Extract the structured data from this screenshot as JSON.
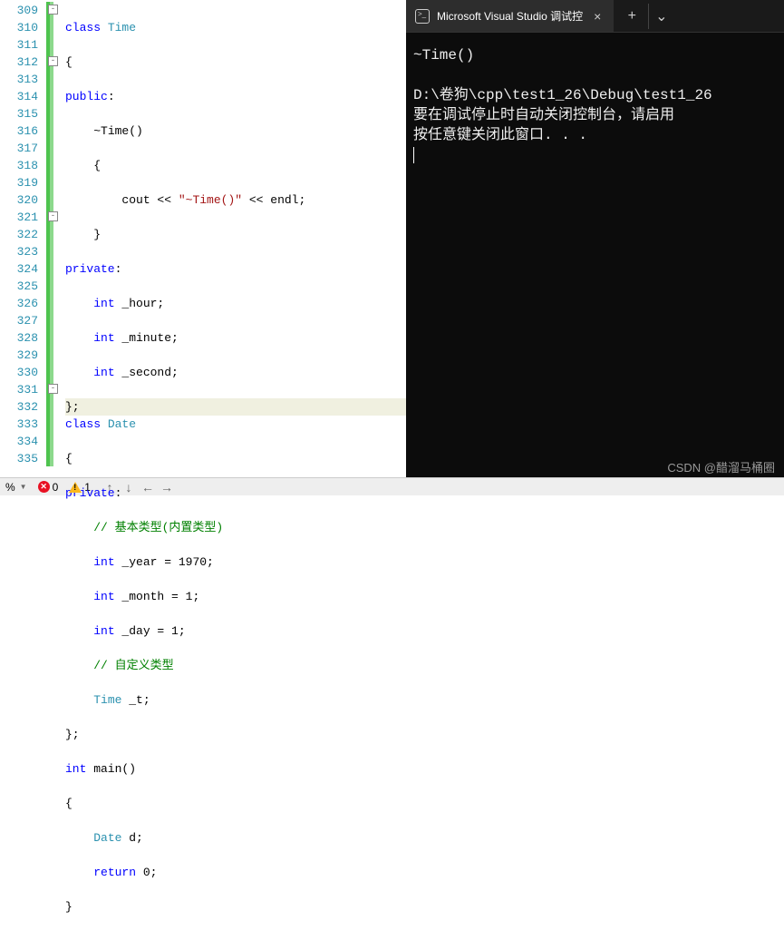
{
  "lines": {
    "start": 309,
    "count": 27
  },
  "code": {
    "l309": {
      "kw": "class",
      "name": "Time"
    },
    "l310": "{",
    "l311": {
      "kw": "public",
      "colon": ":"
    },
    "l312": "~Time()",
    "l313": "{",
    "l314": {
      "pre": "cout << ",
      "str": "\"~Time()\"",
      "post": " << endl;"
    },
    "l315": "}",
    "l316": {
      "kw": "private",
      "colon": ":"
    },
    "l317": {
      "type": "int",
      "name": " _hour;"
    },
    "l318": {
      "type": "int",
      "name": " _minute;"
    },
    "l319": {
      "type": "int",
      "name": " _second;"
    },
    "l320": "};",
    "l321": {
      "kw": "class",
      "name": "Date"
    },
    "l322": "{",
    "l323": {
      "kw": "private",
      "colon": ":"
    },
    "l324": "// 基本类型(内置类型)",
    "l325": {
      "type": "int",
      "name": " _year = 1970;"
    },
    "l326": {
      "type": "int",
      "name": " _month = 1;"
    },
    "l327": {
      "type": "int",
      "name": " _day = 1;"
    },
    "l328": "// 自定义类型",
    "l329": {
      "type": "Time",
      "name": " _t;"
    },
    "l330": "};",
    "l331": {
      "type": "int",
      "name": " main()"
    },
    "l332": "{",
    "l333": {
      "type": "Date",
      "name": " d;"
    },
    "l334": {
      "kw": "return",
      "val": " 0;"
    },
    "l335": "}"
  },
  "terminal": {
    "tab_title": "Microsoft Visual Studio 调试控",
    "output_line1": "~Time()",
    "output_line2": "D:\\卷狗\\cpp\\test1_26\\Debug\\test1_26",
    "output_line3": "要在调试停止时自动关闭控制台，请启用",
    "output_line4": "按任意键关闭此窗口. . ."
  },
  "status": {
    "zoom": "%",
    "errors": "0",
    "warnings": "1"
  },
  "watermark": "CSDN @醋溜马桶圈"
}
